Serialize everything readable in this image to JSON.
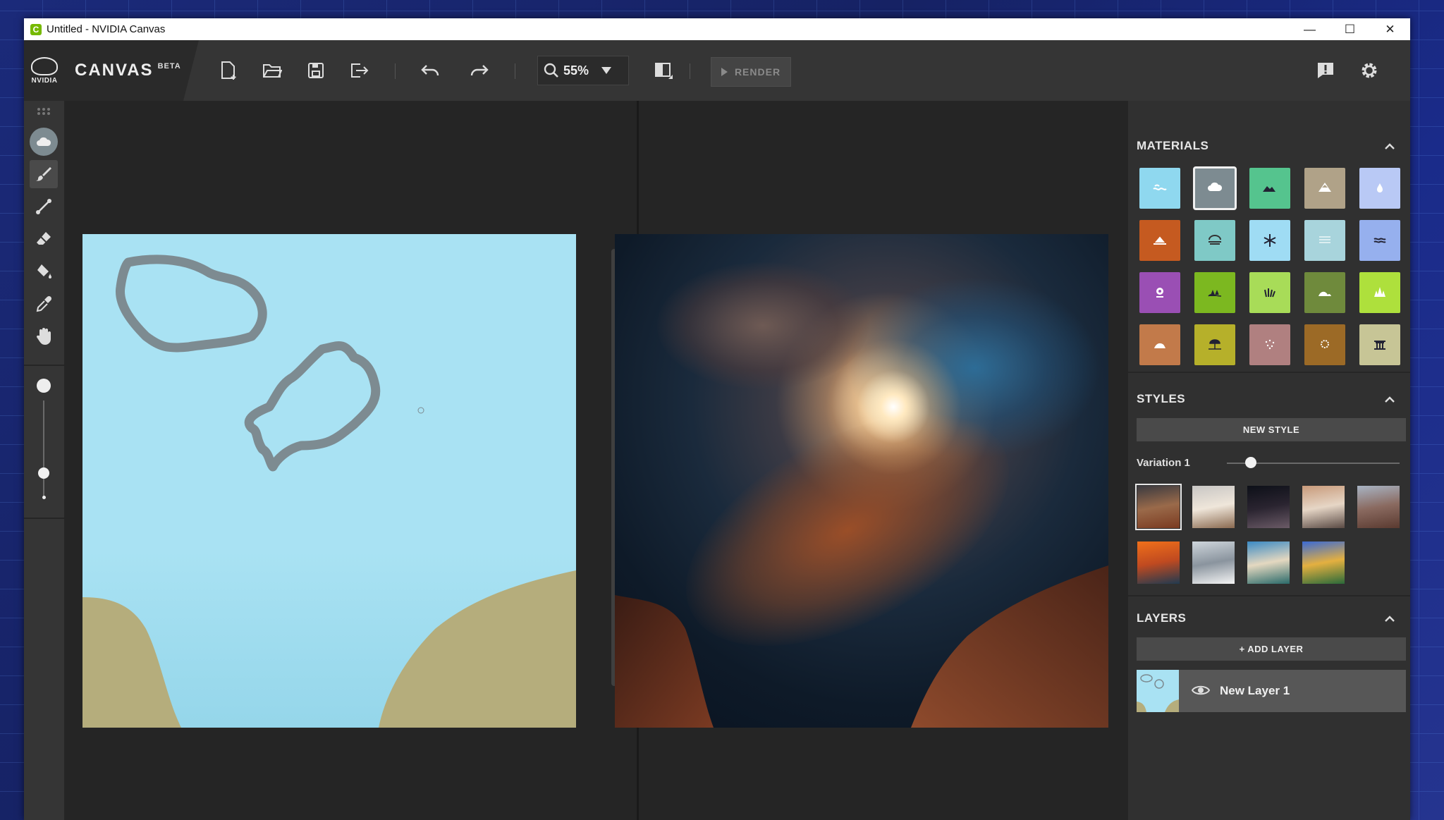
{
  "window": {
    "title": "Untitled - NVIDIA Canvas",
    "controls": [
      "—",
      "☐",
      "✕"
    ]
  },
  "toolbar": {
    "logo_text": "NVIDIA",
    "app_name": "CANVAS",
    "beta_label": "BETA",
    "zoom_value": "55%",
    "render_label": "RENDER",
    "icons": [
      "new-file-icon",
      "open-folder-icon",
      "save-icon",
      "export-icon",
      "undo-icon",
      "redo-icon",
      "search-icon",
      "chevron-down-icon",
      "swap-view-icon",
      "feedback-icon",
      "gear-icon"
    ]
  },
  "tools": [
    "grip-icon",
    "cloud-material-icon",
    "brush-icon",
    "line-icon",
    "eraser-icon",
    "fill-icon",
    "eyedropper-icon",
    "hand-icon"
  ],
  "brush_size": {
    "max_dot": "large",
    "min_dot": "small",
    "value": 0.25
  },
  "materials": {
    "title": "MATERIALS",
    "selected": 1,
    "items": [
      {
        "name": "sea",
        "color": "#8fd8ef"
      },
      {
        "name": "cloud",
        "color": "#7d8b91"
      },
      {
        "name": "mountain",
        "color": "#55c48e"
      },
      {
        "name": "rock",
        "color": "#b0a288"
      },
      {
        "name": "water",
        "color": "#b9c9f5"
      },
      {
        "name": "dirt",
        "color": "#c55a20"
      },
      {
        "name": "fog",
        "color": "#7fc9c6"
      },
      {
        "name": "snow",
        "color": "#9fdcf4"
      },
      {
        "name": "river",
        "color": "#a8d4dc"
      },
      {
        "name": "lake",
        "color": "#96b0ee"
      },
      {
        "name": "flower",
        "color": "#9a4fb4"
      },
      {
        "name": "grass",
        "color": "#7cb820"
      },
      {
        "name": "reeds",
        "color": "#a8dc58"
      },
      {
        "name": "hill",
        "color": "#6f8a3c"
      },
      {
        "name": "tree",
        "color": "#aee03c"
      },
      {
        "name": "sand",
        "color": "#c27a4a"
      },
      {
        "name": "beach",
        "color": "#b6b02a"
      },
      {
        "name": "gravel",
        "color": "#b08080"
      },
      {
        "name": "stone",
        "color": "#9c6a26"
      },
      {
        "name": "building",
        "color": "#c7c596"
      }
    ]
  },
  "styles": {
    "title": "STYLES",
    "new_style_label": "NEW STYLE",
    "variation_label": "Variation 1",
    "variation_value": 0.08,
    "thumbs": [
      {
        "name": "style-desert-rocks",
        "colors": [
          "#3a3a40",
          "#9a6a4a",
          "#7a3a20"
        ]
      },
      {
        "name": "style-cloudy-peaks",
        "colors": [
          "#c8c6c4",
          "#efe6da",
          "#8a6a50"
        ]
      },
      {
        "name": "style-arch-night",
        "colors": [
          "#0d1018",
          "#2a2430",
          "#6a5a66"
        ]
      },
      {
        "name": "style-sunset-fog",
        "colors": [
          "#c89a7a",
          "#e6d6c6",
          "#5a4a44"
        ]
      },
      {
        "name": "style-rocky-cliff",
        "colors": [
          "#a8b4c4",
          "#8a6a60",
          "#5a3a30"
        ]
      },
      {
        "name": "style-ocean-sunset",
        "colors": [
          "#f0701a",
          "#c04a20",
          "#203a50"
        ]
      },
      {
        "name": "style-snowy-mountain",
        "colors": [
          "#cfd6dc",
          "#8a949e",
          "#f4f4f4"
        ]
      },
      {
        "name": "style-tropical-coast",
        "colors": [
          "#3a8ac4",
          "#e4d8c0",
          "#2a6a6a"
        ]
      },
      {
        "name": "style-alpine-lake",
        "colors": [
          "#3a6ad4",
          "#e4b040",
          "#2a6a3a"
        ]
      }
    ]
  },
  "layers": {
    "title": "LAYERS",
    "add_label": "+ ADD LAYER",
    "items": [
      {
        "name": "New Layer 1",
        "visible": true
      }
    ]
  }
}
